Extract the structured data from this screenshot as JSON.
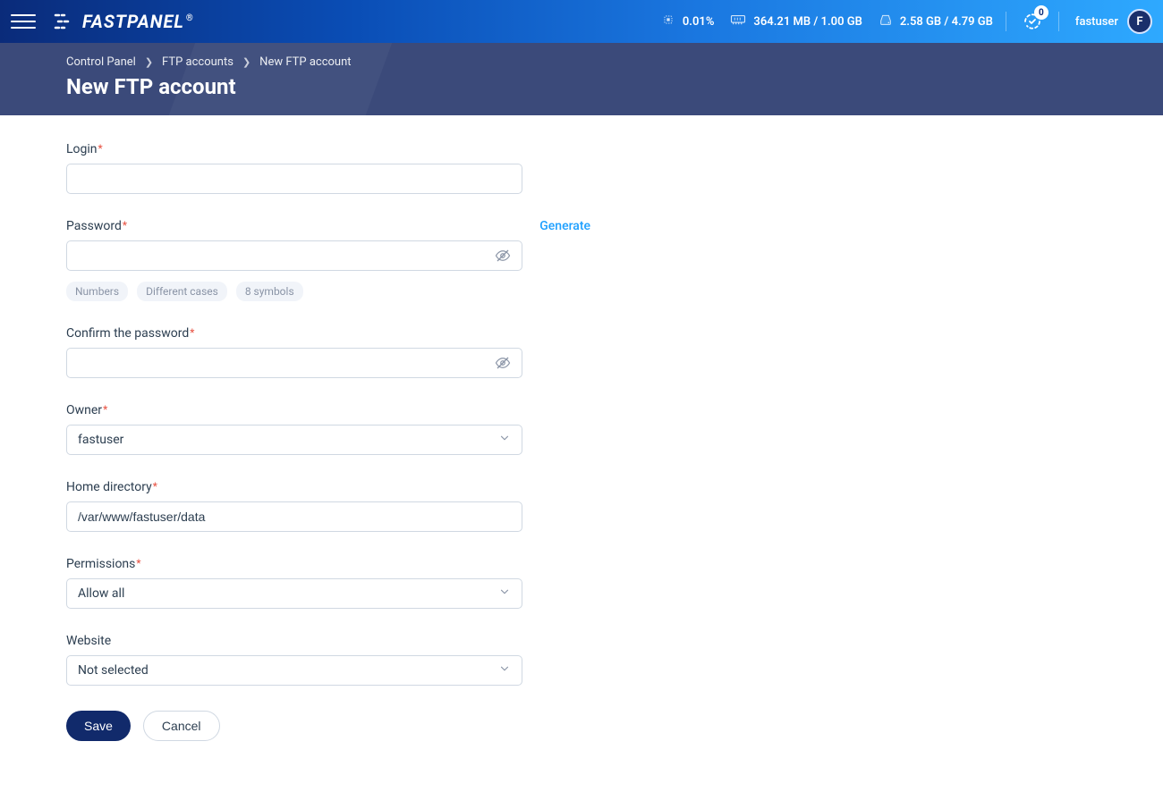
{
  "topbar": {
    "cpu": "0.01%",
    "mem": "364.21 MB / 1.00 GB",
    "disk": "2.58 GB / 4.79 GB",
    "notifications": "0",
    "username": "fastuser",
    "avatar_initial": "F",
    "logo_text": "FASTPANEL"
  },
  "breadcrumb": {
    "a": "Control Panel",
    "b": "FTP accounts",
    "c": "New FTP account"
  },
  "page": {
    "title": "New FTP account"
  },
  "form": {
    "login": {
      "label": "Login",
      "value": ""
    },
    "password": {
      "label": "Password",
      "value": "",
      "generate": "Generate"
    },
    "password_hints": [
      "Numbers",
      "Different cases",
      "8 symbols"
    ],
    "confirm": {
      "label": "Confirm the password",
      "value": ""
    },
    "owner": {
      "label": "Owner",
      "value": "fastuser"
    },
    "home": {
      "label": "Home directory",
      "value": "/var/www/fastuser/data"
    },
    "permissions": {
      "label": "Permissions",
      "value": "Allow all"
    },
    "website": {
      "label": "Website",
      "value": "Not selected"
    }
  },
  "actions": {
    "save": "Save",
    "cancel": "Cancel"
  }
}
